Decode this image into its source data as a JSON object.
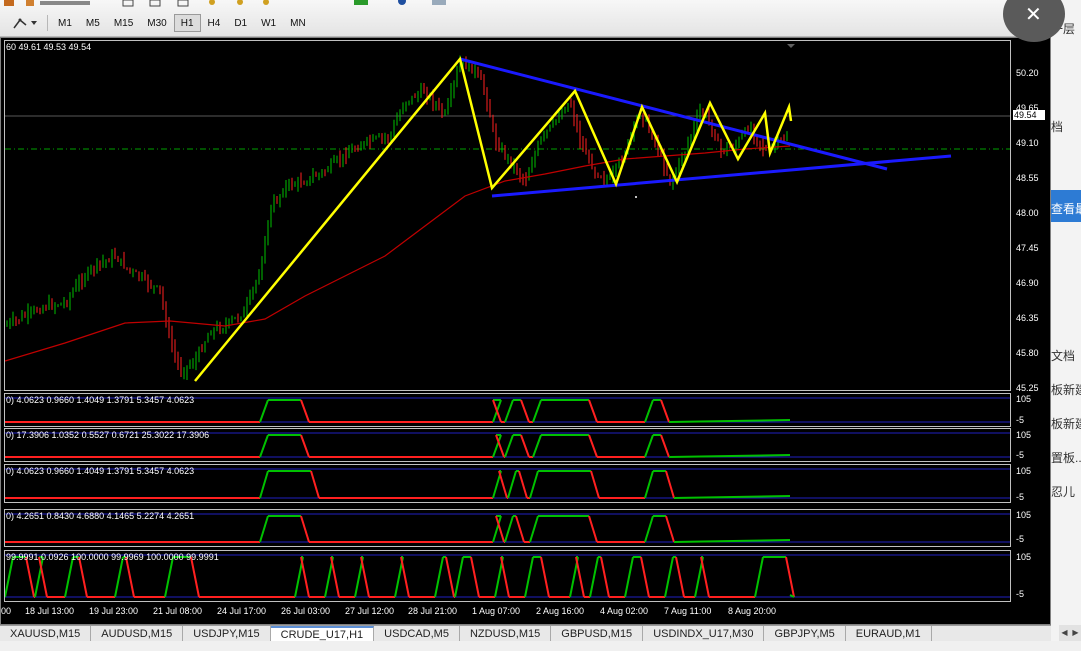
{
  "toolbar": {
    "timeframes": [
      {
        "label": "M1"
      },
      {
        "label": "M5"
      },
      {
        "label": "M15"
      },
      {
        "label": "M30"
      },
      {
        "label": "H1",
        "active": true
      },
      {
        "label": "H4"
      },
      {
        "label": "D1"
      },
      {
        "label": "W1"
      },
      {
        "label": "MN"
      }
    ],
    "icons": [
      "line-studies-icon",
      "chevron-down-icon"
    ]
  },
  "chart": {
    "info": "60 49.61 49.53 49.54",
    "price_levels": [
      "50.20",
      "49.65",
      "49.10",
      "48.55",
      "48.00",
      "47.45",
      "46.90",
      "46.35",
      "45.80",
      "45.25"
    ],
    "current_price": "49.54",
    "time_labels": [
      "00",
      "18 Jul 13:00",
      "19 Jul 23:00",
      "21 Jul 08:00",
      "24 Jul 17:00",
      "26 Jul 03:00",
      "27 Jul 12:00",
      "28 Jul 21:00",
      "1 Aug 07:00",
      "2 Aug 16:00",
      "4 Aug 02:00",
      "7 Aug 11:00",
      "8 Aug 20:00"
    ],
    "colors": {
      "bull": "#00c000",
      "bear": "#ff2020",
      "ma": "#c00000",
      "trend": "#1a1aff",
      "pattern": "#ffff00"
    }
  },
  "indicators": [
    {
      "info": "0) 4.0623 0.9660 1.4049 1.3791 5.3457 4.0623",
      "scale_top": "105",
      "scale_bottom": "-5"
    },
    {
      "info": "0) 17.3906 1.0352 0.5527 0.6721 25.3022 17.3906",
      "scale_top": "105",
      "scale_bottom": "-5"
    },
    {
      "info": "0) 4.0623 0.9660 1.4049 1.3791 5.3457 4.0623",
      "scale_top": "105",
      "scale_bottom": "-5"
    },
    {
      "info": "0) 4.2651 0.8430 4.6880 4.1465 5.2274 4.2651",
      "scale_top": "105",
      "scale_bottom": "-5"
    },
    {
      "info": "99.9991 0.0926 100.0000 99.9969 100.0000 99.9991",
      "scale_top": "105",
      "scale_bottom": "-5"
    }
  ],
  "tabs": [
    {
      "label": "XAUUSD,M15"
    },
    {
      "label": "AUDUSD,M15"
    },
    {
      "label": "USDJPY,M15"
    },
    {
      "label": "CRUDE_U17,H1",
      "active": true
    },
    {
      "label": "USDCAD,M5"
    },
    {
      "label": "NZDUSD,M15"
    },
    {
      "label": "GBPUSD,M15"
    },
    {
      "label": "USDINDX_U17,M30"
    },
    {
      "label": "GBPJPY,M5"
    },
    {
      "label": "EURAUD,M1"
    }
  ],
  "side": {
    "texts": [
      "一层",
      "档",
      "查看最",
      "文档",
      "板新建",
      "板新建",
      "置板...",
      "忍儿"
    ],
    "close_icon": "close-icon"
  }
}
